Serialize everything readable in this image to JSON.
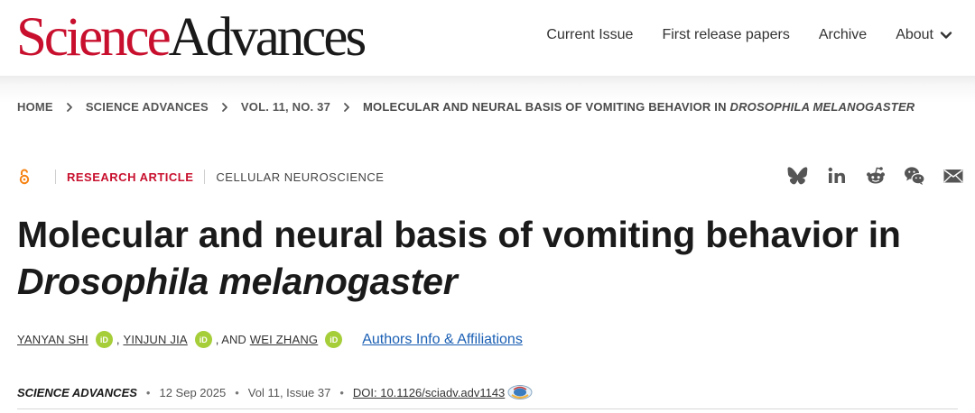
{
  "header": {
    "logo_science": "Science",
    "logo_advances": "Advances",
    "nav": {
      "current_issue": "Current Issue",
      "first_release": "First release papers",
      "archive": "Archive",
      "about": "About"
    }
  },
  "breadcrumb": {
    "home": "HOME",
    "journal": "SCIENCE ADVANCES",
    "issue": "VOL. 11, NO. 37",
    "current_prefix": "MOLECULAR AND NEURAL BASIS OF VOMITING BEHAVIOR IN ",
    "current_italic": "DROSOPHILA MELANOGASTER"
  },
  "meta": {
    "article_type": "RESEARCH ARTICLE",
    "subject": "CELLULAR NEUROSCIENCE"
  },
  "share": {
    "icons": [
      "bluesky-icon",
      "linkedin-icon",
      "reddit-icon",
      "wechat-icon",
      "email-icon"
    ]
  },
  "article": {
    "title_line1": "Molecular and neural basis of vomiting behavior in",
    "title_line2": "Drosophila melanogaster"
  },
  "authors": {
    "author1": "YANYAN SHI",
    "author2": "YINJUN JIA",
    "and_text": ", AND",
    "comma": ",",
    "author3": "WEI ZHANG",
    "orcid_label": "iD",
    "affiliations_link": "Authors Info & Affiliations"
  },
  "citation": {
    "journal": "SCIENCE ADVANCES",
    "date": "12 Sep 2025",
    "volume": "Vol 11, Issue 37",
    "doi": "DOI: 10.1126/sciadv.adv1143"
  },
  "colors": {
    "brand_red": "#c8102e",
    "orcid_green": "#a6ce39",
    "link_blue": "#1a5fb4",
    "open_access_orange": "#f68212"
  }
}
